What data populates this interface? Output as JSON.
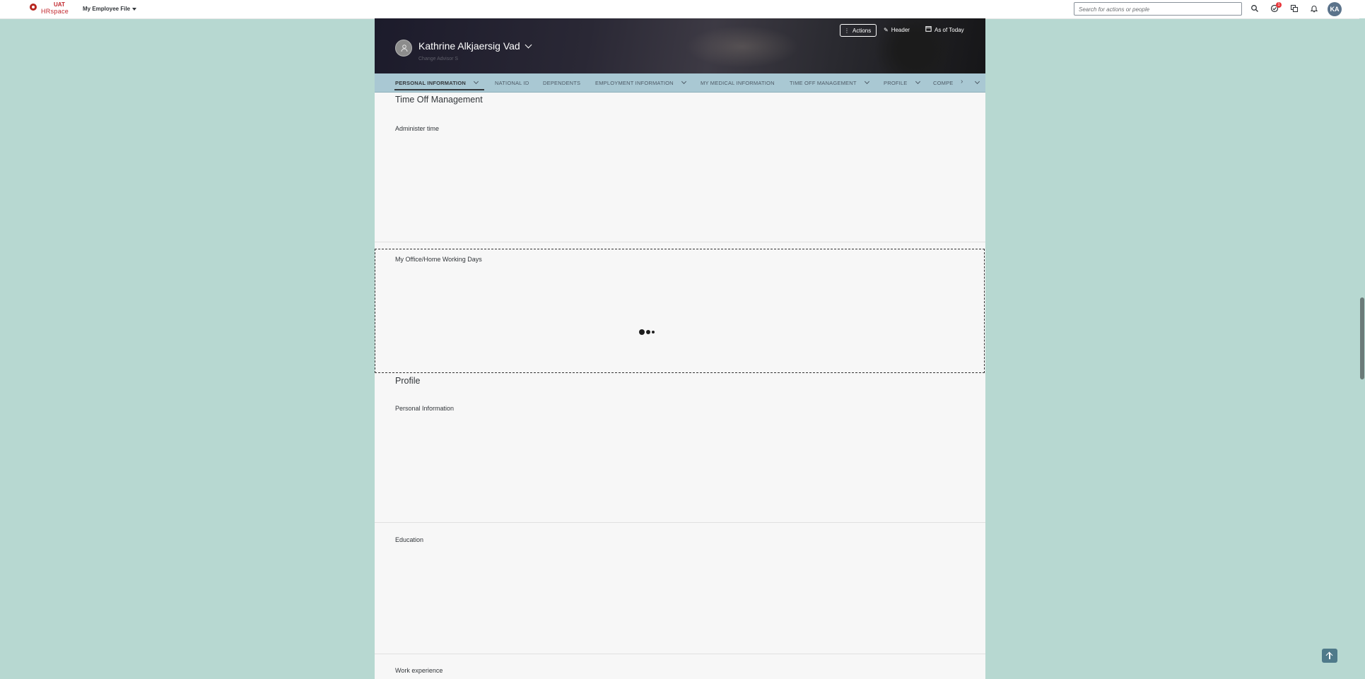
{
  "shell": {
    "logo_uat": "UAT",
    "logo_brand": "HRspace",
    "app_title": "My Employee File",
    "search_placeholder": "Search for actions or people",
    "todo_badge": "1",
    "avatar_initials": "KA"
  },
  "header": {
    "employee_name": "Kathrine Alkjaersig Vad",
    "employee_subtitle": "Change Advisor S",
    "actions_label": "Actions",
    "header_label": "Header",
    "as_of_label": "As of Today"
  },
  "tabs": [
    {
      "label": "PERSONAL INFORMATION",
      "active": true,
      "has_menu": true
    },
    {
      "label": "NATIONAL ID",
      "active": false,
      "has_menu": false
    },
    {
      "label": "DEPENDENTS",
      "active": false,
      "has_menu": false
    },
    {
      "label": "EMPLOYMENT INFORMATION",
      "active": false,
      "has_menu": true
    },
    {
      "label": "MY MEDICAL INFORMATION",
      "active": false,
      "has_menu": false
    },
    {
      "label": "TIME OFF MANAGEMENT",
      "active": false,
      "has_menu": true
    },
    {
      "label": "PROFILE",
      "active": false,
      "has_menu": true
    },
    {
      "label": "COMPE",
      "active": false,
      "has_menu": false
    }
  ],
  "sections": {
    "time_off_title": "Time Off Management",
    "administer_time": "Administer time",
    "office_home_days": "My Office/Home Working Days",
    "profile_title": "Profile",
    "personal_information": "Personal Information",
    "education": "Education",
    "work_experience": "Work experience"
  },
  "colors": {
    "page_bg": "#b7d8d1",
    "tab_bar": "#a9c8d3",
    "accent_red": "#c1272d",
    "avatar_bg": "#5b738b"
  }
}
